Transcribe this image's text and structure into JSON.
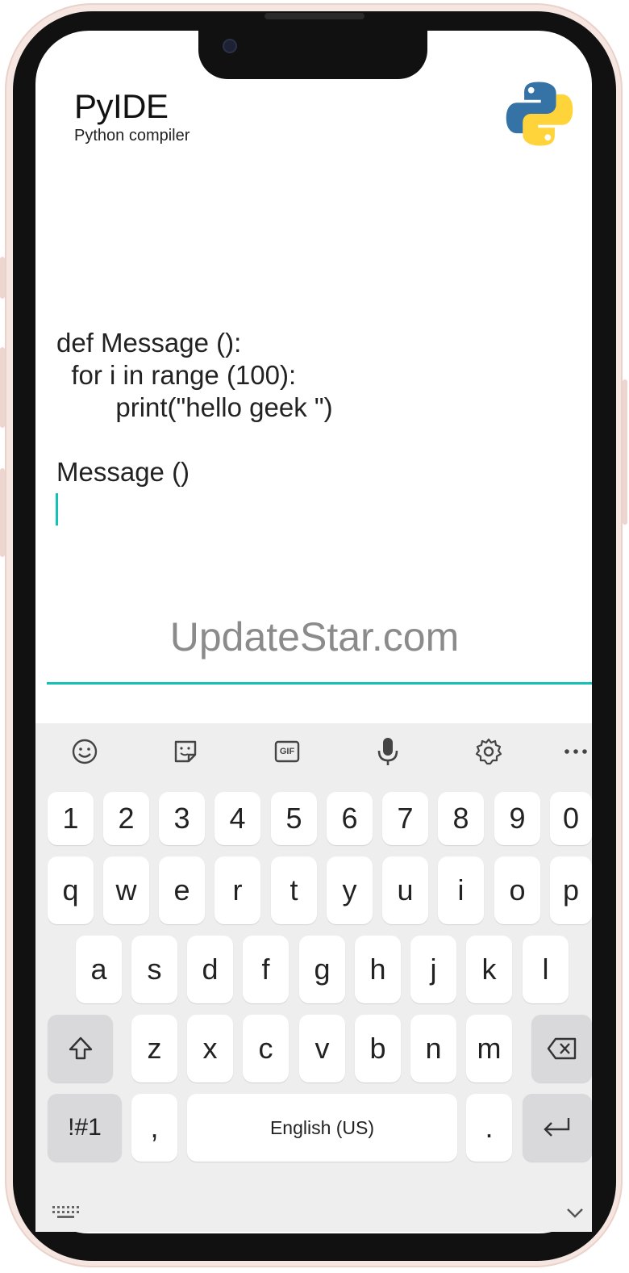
{
  "app": {
    "title": "PyIDE",
    "subtitle": "Python compiler",
    "logo_icon": "python-logo-icon"
  },
  "editor": {
    "lines": [
      "def Message ():",
      "  for i in range (100):",
      "        print(\"hello geek \")",
      "",
      "Message ()"
    ]
  },
  "watermark": "UpdateStar.com",
  "keyboard": {
    "toolbar": [
      {
        "name": "emoji-icon"
      },
      {
        "name": "sticker-icon"
      },
      {
        "name": "gif-icon"
      },
      {
        "name": "microphone-icon"
      },
      {
        "name": "gear-icon"
      },
      {
        "name": "more-icon"
      }
    ],
    "numbers": [
      "1",
      "2",
      "3",
      "4",
      "5",
      "6",
      "7",
      "8",
      "9",
      "0"
    ],
    "row1": [
      "q",
      "w",
      "e",
      "r",
      "t",
      "y",
      "u",
      "i",
      "o",
      "p"
    ],
    "row2": [
      "a",
      "s",
      "d",
      "f",
      "g",
      "h",
      "j",
      "k",
      "l"
    ],
    "row3": [
      "z",
      "x",
      "c",
      "v",
      "b",
      "n",
      "m"
    ],
    "symbols_label": "!#1",
    "comma_label": ",",
    "space_label": "English (US)",
    "period_label": ".",
    "gif_label": "GIF"
  },
  "colors": {
    "accent": "#14c1b5",
    "frame": "#f6e6e1",
    "python_blue": "#3572a5",
    "python_yellow": "#ffd43b"
  }
}
